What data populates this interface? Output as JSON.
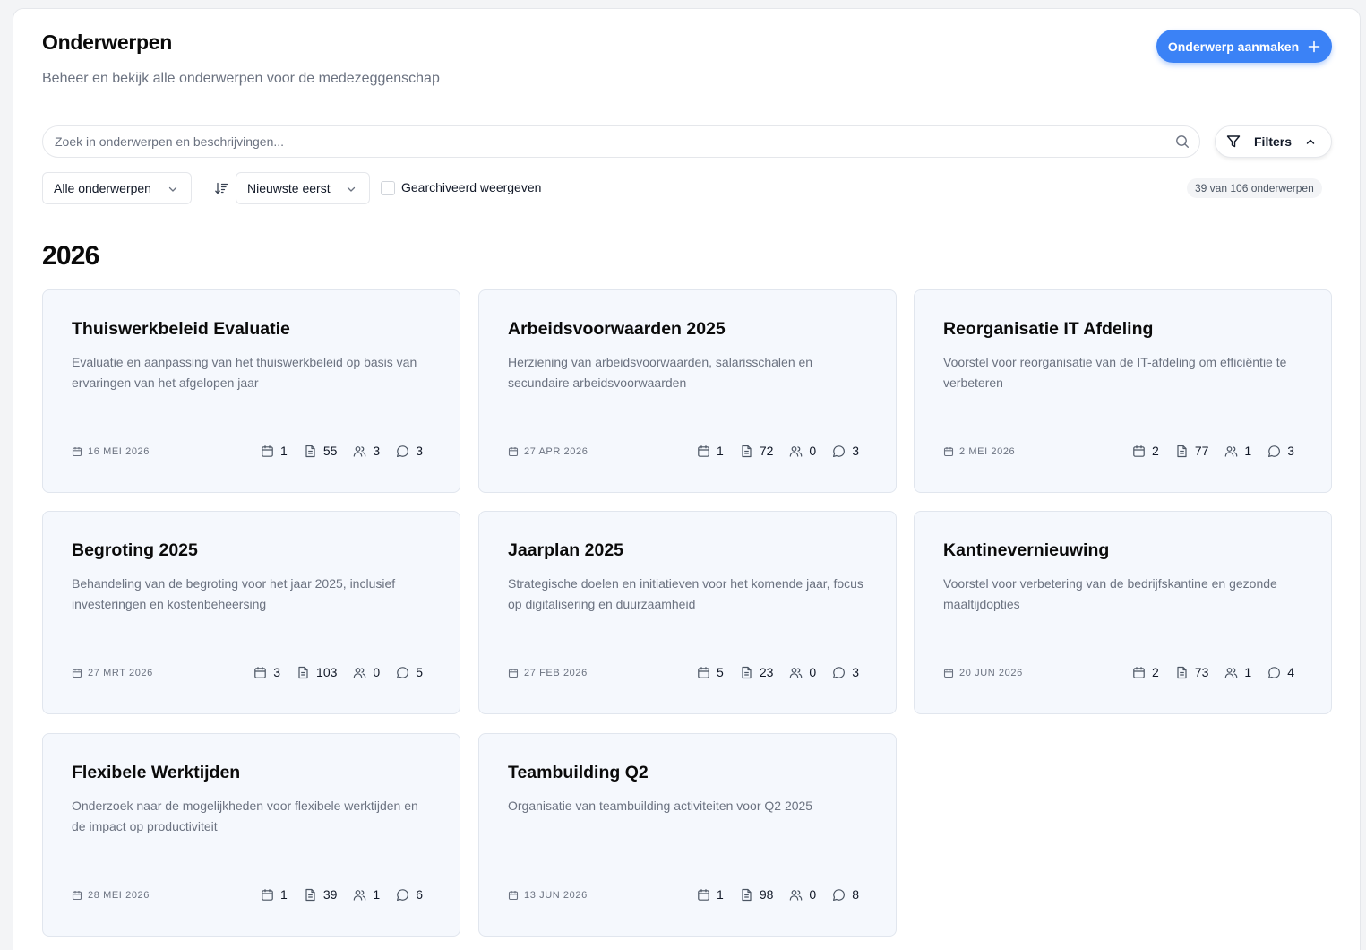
{
  "header": {
    "title": "Onderwerpen",
    "subtitle": "Beheer en bekijk alle onderwerpen voor de medezeggenschap",
    "create_button_label": "Onderwerp aanmaken"
  },
  "search": {
    "placeholder": "Zoek in onderwerpen en beschrijvingen...",
    "value": ""
  },
  "filters": {
    "button_label": "Filters",
    "category_select": "Alle onderwerpen",
    "sort_select": "Nieuwste eerst",
    "archived_label": "Gearchiveerd weergeven",
    "archived_checked": false,
    "count_text": "39 van 106 onderwerpen"
  },
  "sections": [
    {
      "year": "2026",
      "cards": [
        {
          "title": "Thuiswerkbeleid Evaluatie",
          "description": "Evaluatie en aanpassing van het thuiswerkbeleid op basis van ervaringen van het afgelopen jaar",
          "date": "16 MEI 2026",
          "meetings": "1",
          "documents": "55",
          "participants": "3",
          "comments": "3"
        },
        {
          "title": "Arbeidsvoorwaarden 2025",
          "description": "Herziening van arbeidsvoorwaarden, salarisschalen en secundaire arbeidsvoorwaarden",
          "date": "27 APR 2026",
          "meetings": "1",
          "documents": "72",
          "participants": "0",
          "comments": "3"
        },
        {
          "title": "Reorganisatie IT Afdeling",
          "description": "Voorstel voor reorganisatie van de IT-afdeling om efficiëntie te verbeteren",
          "date": "2 MEI 2026",
          "meetings": "2",
          "documents": "77",
          "participants": "1",
          "comments": "3"
        },
        {
          "title": "Begroting 2025",
          "description": "Behandeling van de begroting voor het jaar 2025, inclusief investeringen en kostenbeheersing",
          "date": "27 MRT 2026",
          "meetings": "3",
          "documents": "103",
          "participants": "0",
          "comments": "5"
        },
        {
          "title": "Jaarplan 2025",
          "description": "Strategische doelen en initiatieven voor het komende jaar, focus op digitalisering en duurzaamheid",
          "date": "27 FEB 2026",
          "meetings": "5",
          "documents": "23",
          "participants": "0",
          "comments": "3"
        },
        {
          "title": "Kantinevernieuwing",
          "description": "Voorstel voor verbetering van de bedrijfskantine en gezonde maaltijdopties",
          "date": "20 JUN 2026",
          "meetings": "2",
          "documents": "73",
          "participants": "1",
          "comments": "4"
        },
        {
          "title": "Flexibele Werktijden",
          "description": "Onderzoek naar de mogelijkheden voor flexibele werktijden en de impact op productiviteit",
          "date": "28 MEI 2026",
          "meetings": "1",
          "documents": "39",
          "participants": "1",
          "comments": "6"
        },
        {
          "title": "Teambuilding Q2",
          "description": "Organisatie van teambuilding activiteiten voor Q2 2025",
          "date": "13 JUN 2026",
          "meetings": "1",
          "documents": "98",
          "participants": "0",
          "comments": "8"
        }
      ]
    }
  ],
  "icons": {
    "create": "plus-icon",
    "search": "search-icon",
    "filters": "filter-icon",
    "filters_toggle": "chevron-up-icon",
    "select": "chevron-down-icon",
    "sort": "sort-icon",
    "date": "calendar-icon",
    "meetings": "calendar-icon",
    "documents": "document-icon",
    "participants": "users-icon",
    "comments": "comment-icon"
  },
  "colors": {
    "accent": "#3b82f6",
    "card_background": "#f5f8fd",
    "muted_text": "#6b7280"
  }
}
